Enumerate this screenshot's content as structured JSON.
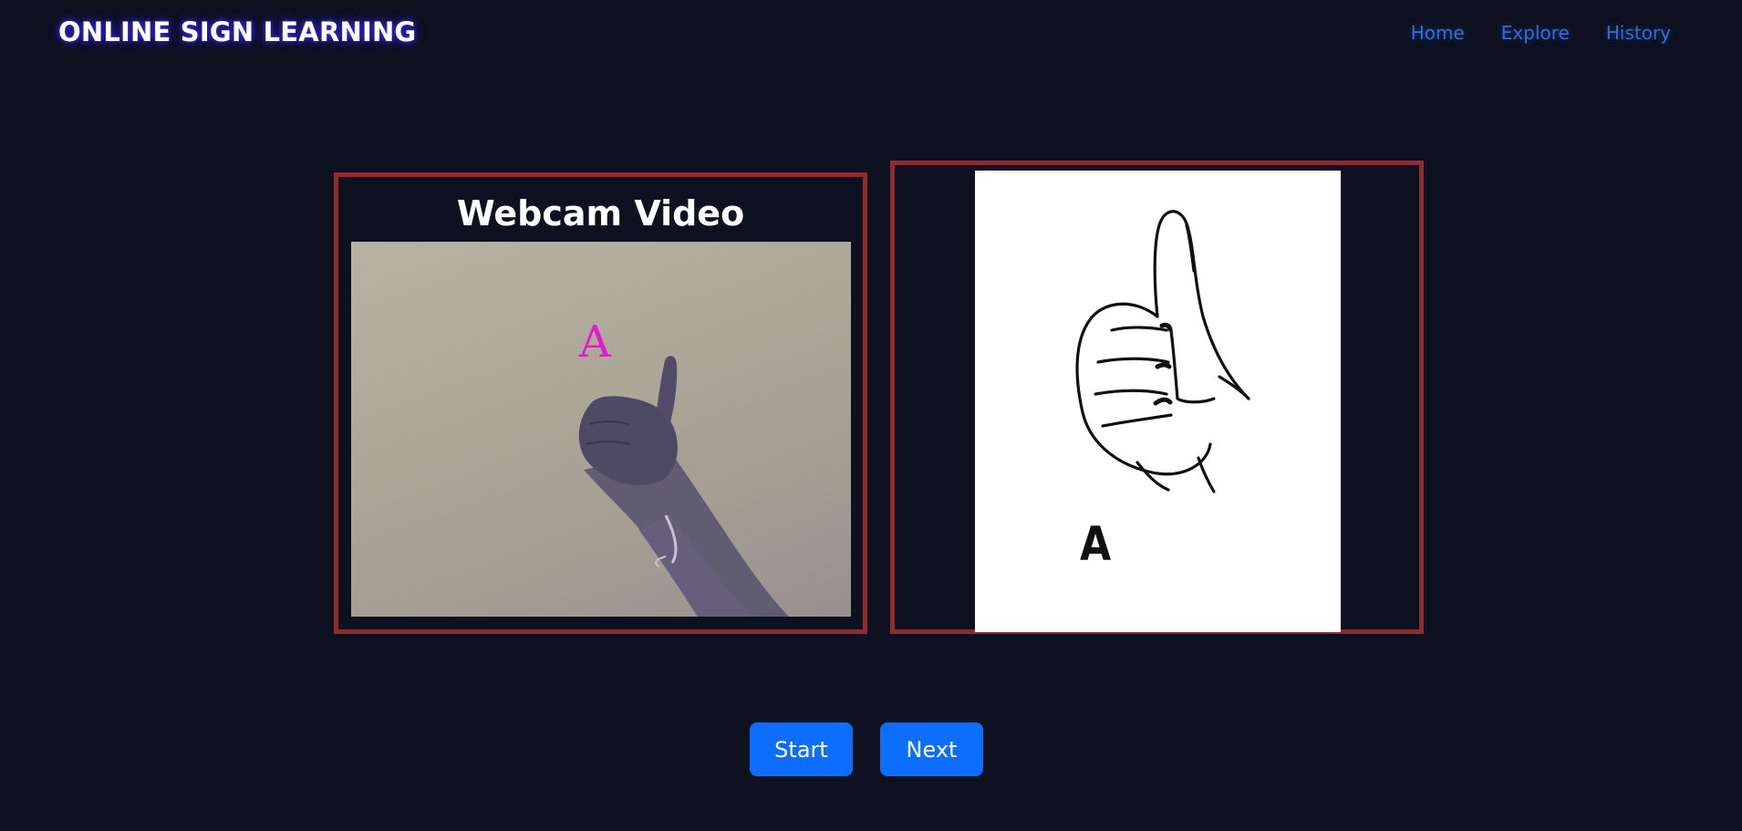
{
  "header": {
    "brand": "ONLINE SIGN LEARNING",
    "nav": [
      {
        "label": "Home"
      },
      {
        "label": "Explore"
      },
      {
        "label": "History"
      }
    ]
  },
  "webcam_panel": {
    "title": "Webcam Video",
    "detected_letter": "A"
  },
  "reference_panel": {
    "letter": "A"
  },
  "controls": {
    "start_label": "Start",
    "next_label": "Next"
  },
  "colors": {
    "background": "#0d1120",
    "panel_border": "#932a2e",
    "button": "#0d6efd",
    "nav_link": "#2f6fe0",
    "overlay_letter": "#e21ad0"
  }
}
